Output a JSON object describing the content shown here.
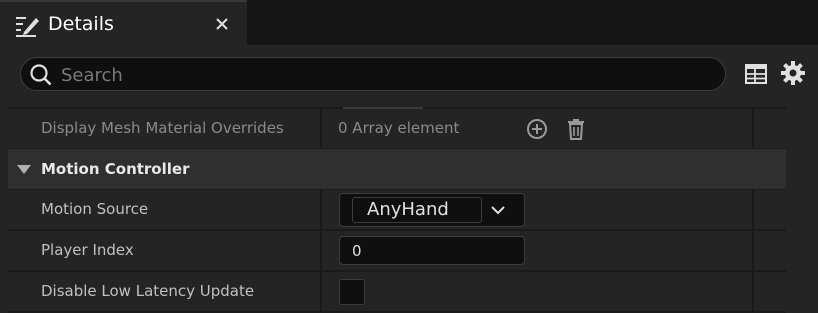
{
  "tab": {
    "title": "Details",
    "icon": "edit-pencil-icon",
    "close_icon": "close-icon"
  },
  "search": {
    "placeholder": "Search",
    "value": ""
  },
  "toolbar": {
    "table_icon": "table-view-icon",
    "settings_icon": "gear-icon"
  },
  "rows": {
    "material_overrides": {
      "label": "Display Mesh Material Overrides",
      "value": "0 Array element"
    },
    "category": {
      "title": "Motion Controller",
      "expanded": true
    },
    "motion_source": {
      "label": "Motion Source",
      "value": "AnyHand"
    },
    "player_index": {
      "label": "Player Index",
      "value": "0"
    },
    "disable_low_latency": {
      "label": "Disable Low Latency Update",
      "checked": false
    }
  },
  "colors": {
    "panel_bg": "#242424",
    "category_bg": "#2f2f2f",
    "input_bg": "#0f0f0f",
    "text": "#c0c0c0"
  }
}
